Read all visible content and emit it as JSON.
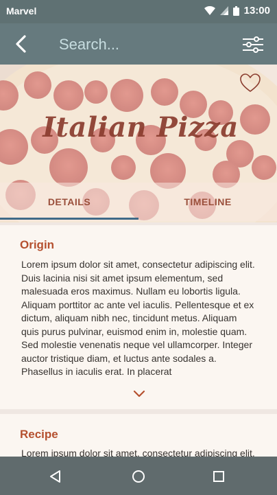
{
  "status_bar": {
    "carrier": "Marvel",
    "time": "13:00",
    "icons": [
      "wifi-icon",
      "signal-icon",
      "battery-icon"
    ]
  },
  "app_bar": {
    "back_icon": "chevron-left-icon",
    "search_placeholder": "Search...",
    "filter_icon": "sliders-icon"
  },
  "hero": {
    "title": "Italian Pizza",
    "favorite_icon": "heart-outline-icon"
  },
  "tabs": [
    {
      "label": "DETAILS",
      "active": true
    },
    {
      "label": "TIMELINE",
      "active": false
    }
  ],
  "sections": [
    {
      "title": "Origin",
      "body": "Lorem ipsum dolor sit amet, consectetur adipiscing elit. Duis lacinia nisi sit amet ipsum elementum, sed malesuada eros maximus. Nullam eu lobortis ligula. Aliquam porttitor ac ante vel iaculis. Pellentesque et ex dictum, aliquam nibh nec, tincidunt metus. Aliquam quis purus pulvinar, euismod enim in, molestie quam. Sed molestie venenatis neque vel ullamcorper. Integer auctor tristique diam, et luctus ante sodales a. Phasellus in iaculis erat. In placerat",
      "expand_icon": "chevron-down-icon"
    },
    {
      "title": "Recipe",
      "body": "Lorem ipsum dolor sit amet, consectetur adipiscing elit. Duis lacinia nisi sit amet ipsum elementum, sed malesuada eros maximus."
    }
  ],
  "nav_bar": {
    "icons": [
      "back-triangle-icon",
      "home-circle-icon",
      "recents-square-icon"
    ]
  },
  "colors": {
    "status_bar": "#5f7173",
    "app_bar": "#667a7e",
    "accent": "#b5502f",
    "tab_text": "#9a4f3b",
    "tab_indicator": "#3f6a88",
    "card_bg": "#fbf6f1",
    "nav_bar": "#606b6d"
  }
}
